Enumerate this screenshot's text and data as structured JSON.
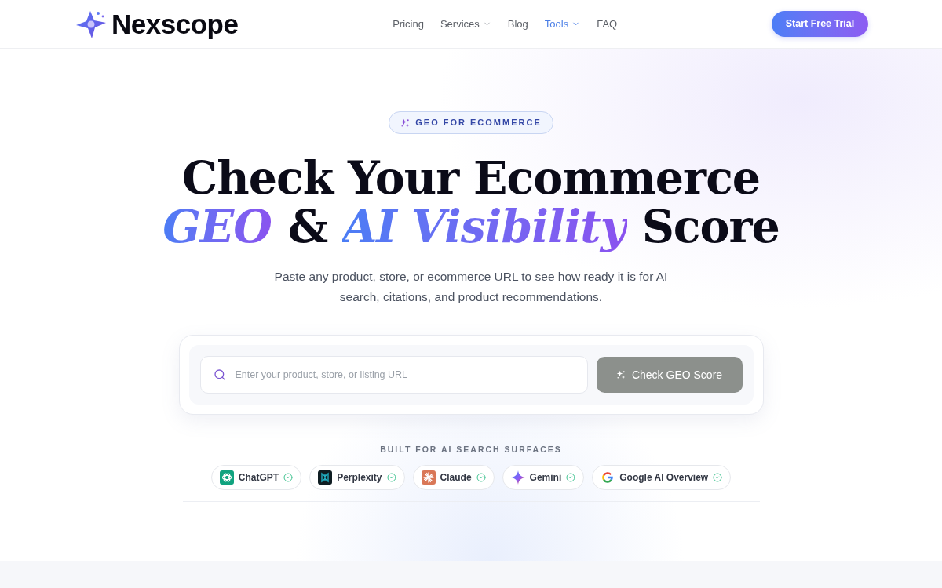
{
  "header": {
    "logo": {
      "text": "Nexscope"
    },
    "nav": [
      {
        "label": "Pricing",
        "selected": false,
        "has_menu": false
      },
      {
        "label": "Services",
        "selected": false,
        "has_menu": true
      },
      {
        "label": "Blog",
        "selected": false,
        "has_menu": false
      },
      {
        "label": "Tools",
        "selected": true,
        "has_menu": true
      },
      {
        "label": "FAQ",
        "selected": false,
        "has_menu": false
      }
    ],
    "cta": {
      "label": "Start Free Trial"
    }
  },
  "hero": {
    "badge": {
      "label": "GEO FOR ECOMMERCE"
    },
    "heading": {
      "line_1": "Check Your Ecommerce",
      "line_2": [
        {
          "text": "GEO",
          "highlight": true
        },
        {
          "text": "&",
          "highlight": false
        },
        {
          "text": "AI Visibility",
          "highlight": true
        },
        {
          "text": "Score",
          "highlight": false
        }
      ]
    },
    "subtitle": "Paste any product, store, or ecommerce URL to see how ready it is for AI search, citations, and product recommendations.",
    "search": {
      "placeholder": "Enter your product, store, or listing URL",
      "button": {
        "label": "Check GEO Score",
        "disabled": true
      }
    },
    "surfaces": {
      "title": "BUILT FOR AI SEARCH SURFACES",
      "items": [
        {
          "label": "ChatGPT",
          "kind": "knot",
          "verified": true
        },
        {
          "label": "Perplexity",
          "kind": "frame",
          "verified": true
        },
        {
          "label": "Claude",
          "kind": "burst",
          "verified": true
        },
        {
          "label": "Gemini",
          "kind": "sparkle",
          "verified": true
        },
        {
          "label": "Google AI Overview",
          "kind": "ring",
          "verified": true
        }
      ]
    }
  }
}
